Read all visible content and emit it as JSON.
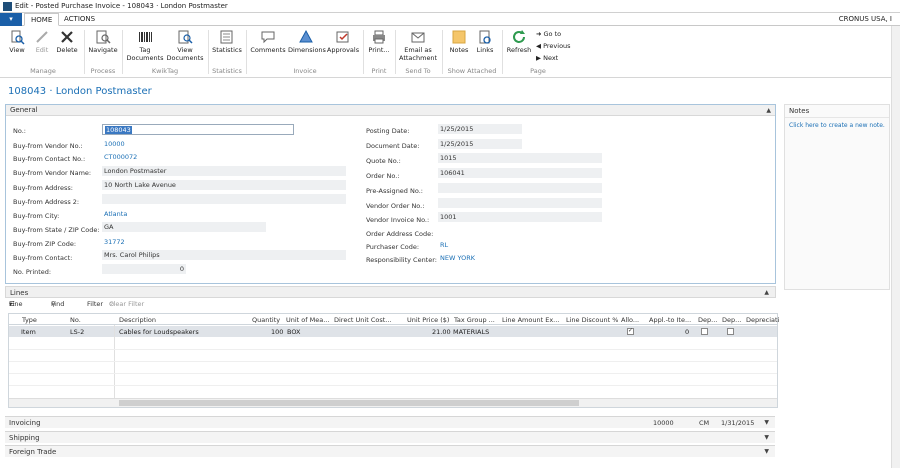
{
  "window": {
    "title": "Edit - Posted Purchase Invoice - 108043 · London Postmaster",
    "company": "CRONUS USA, I"
  },
  "tabs": [
    {
      "label": "HOME",
      "active": true
    },
    {
      "label": "ACTIONS",
      "active": false
    }
  ],
  "ribbon": {
    "buttons": {
      "view": "View",
      "edit": "Edit",
      "delete": "Delete",
      "navigate": "Navigate",
      "tag_documents": "Tag Documents",
      "view_documents": "View Documents",
      "statistics": "Statistics",
      "comments": "Comments",
      "dimensions": "Dimensions",
      "approvals": "Approvals",
      "print": "Print...",
      "email": "Email as Attachment",
      "notes": "Notes",
      "links": "Links",
      "refresh": "Refresh",
      "go_to": "Go to",
      "previous": "Previous",
      "next": "Next"
    },
    "groups": {
      "manage": "Manage",
      "process": "Process",
      "kwiktag": "KwikTag",
      "statistics": "Statistics",
      "invoice": "Invoice",
      "print": "Print",
      "send_to": "Send To",
      "show_attached": "Show Attached",
      "page": "Page"
    }
  },
  "page_title": "108043 · London Postmaster",
  "general": {
    "header": "General",
    "left": [
      {
        "label": "No.:",
        "value": "108043"
      },
      {
        "label": "Buy-from Vendor No.:",
        "value": "10000"
      },
      {
        "label": "Buy-from Contact No.:",
        "value": "CT000072"
      },
      {
        "label": "Buy-from Vendor Name:",
        "value": "London Postmaster"
      },
      {
        "label": "Buy-from Address:",
        "value": "10 North Lake Avenue"
      },
      {
        "label": "Buy-from Address 2:",
        "value": ""
      },
      {
        "label": "Buy-from City:",
        "value": "Atlanta"
      },
      {
        "label": "Buy-from State / ZIP Code:",
        "value": "GA"
      },
      {
        "label": "Buy-from ZIP Code:",
        "value": "31772"
      },
      {
        "label": "Buy-from Contact:",
        "value": "Mrs. Carol Philips"
      },
      {
        "label": "No. Printed:",
        "value": "0"
      }
    ],
    "right": [
      {
        "label": "Posting Date:",
        "value": "1/25/2015"
      },
      {
        "label": "Document Date:",
        "value": "1/25/2015"
      },
      {
        "label": "Quote No.:",
        "value": "1015"
      },
      {
        "label": "Order No.:",
        "value": "106041"
      },
      {
        "label": "Pre-Assigned No.:",
        "value": ""
      },
      {
        "label": "Vendor Order No.:",
        "value": ""
      },
      {
        "label": "Vendor Invoice No.:",
        "value": "1001"
      },
      {
        "label": "Order Address Code:",
        "value": ""
      },
      {
        "label": "Purchaser Code:",
        "value": "RL"
      },
      {
        "label": "Responsibility Center:",
        "value": "NEW YORK"
      }
    ]
  },
  "notes": {
    "header": "Notes",
    "link": "Click here to create a new note."
  },
  "lines": {
    "header": "Lines",
    "toolbar": {
      "line": "Line",
      "find": "Find",
      "filter": "Filter",
      "clear_filter": "Clear Filter"
    },
    "columns": [
      "Type",
      "No.",
      "Description",
      "Quantity",
      "Unit of Mea...",
      "Direct Unit Cost...",
      "Unit Price ($)",
      "Tax Group ...",
      "Line Amount Ex...",
      "Line Discount %",
      "Allo...",
      "Appl.-to Ite...",
      "Dep...",
      "Dep...",
      "Depreciati"
    ],
    "row": {
      "type": "Item",
      "no": "LS-2",
      "description": "Cables for Loudspeakers",
      "quantity": "100",
      "unit": "BOX",
      "unit_price": "21.00",
      "tax_group": "MATERIALS",
      "appl_to_item": "0"
    }
  },
  "invoicing": {
    "label": "Invoicing",
    "vendor": "10000",
    "currency": "CM",
    "date": "1/31/2015"
  },
  "shipping": {
    "label": "Shipping"
  },
  "foreign_trade": {
    "label": "Foreign Trade"
  }
}
